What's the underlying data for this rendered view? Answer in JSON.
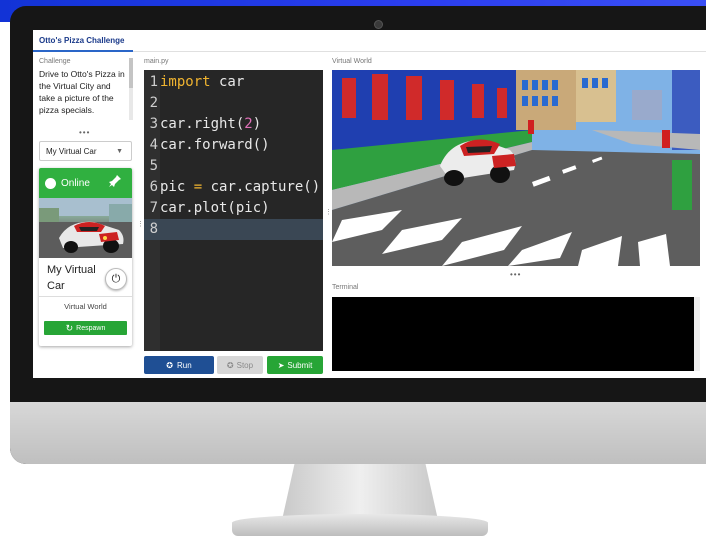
{
  "tab": {
    "title": "Otto's Pizza Challenge"
  },
  "challenge": {
    "label": "Challenge",
    "text": "Drive to Otto's Pizza in the Virtual City and take a picture of the pizza specials."
  },
  "car_select": {
    "value": "My Virtual Car"
  },
  "car_card": {
    "status": "Online",
    "name": "My Virtual Car",
    "world": "Virtual World",
    "respawn_label": "Respawn"
  },
  "editor": {
    "filename": "main.py",
    "lines": [
      {
        "num": "1",
        "text": "import car"
      },
      {
        "num": "2",
        "text": ""
      },
      {
        "num": "3",
        "text": "car.right(2)"
      },
      {
        "num": "4",
        "text": "car.forward()"
      },
      {
        "num": "5",
        "text": ""
      },
      {
        "num": "6",
        "text": "pic = car.capture()"
      },
      {
        "num": "7",
        "text": "car.plot(pic)"
      },
      {
        "num": "8",
        "text": ""
      }
    ]
  },
  "controls": {
    "run_label": "Run",
    "stop_label": "Stop",
    "submit_label": "Submit"
  },
  "world": {
    "label": "Virtual World"
  },
  "terminal": {
    "label": "Terminal"
  },
  "colors": {
    "accent_blue": "#1f4f94",
    "green": "#27a536",
    "editor_bg": "#262626",
    "keyword": "#f0b430",
    "number": "#e070b8"
  }
}
